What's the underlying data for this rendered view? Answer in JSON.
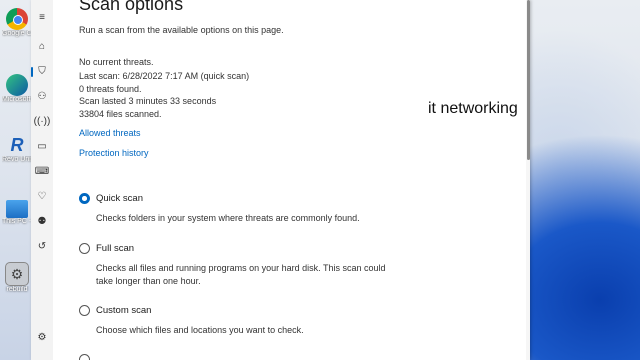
{
  "desktop": {
    "icons": [
      {
        "label": "Google Chrome",
        "short": "Goog\nChrom",
        "icon": "chrome-icon"
      },
      {
        "label": "Microsoft Edge",
        "short": "Micro\nEdg",
        "icon": "edge-icon"
      },
      {
        "label": "Revo Uninstaller",
        "short": "Rev\nUninst",
        "icon": "revo-icon"
      },
      {
        "label": "This PC - Shortcut",
        "short": "This P\nShort",
        "icon": "pc-icon"
      },
      {
        "label": "rebuild",
        "short": "rebu",
        "icon": "gear-app-icon"
      }
    ]
  },
  "window": {
    "nav": [
      "menu-icon",
      "home-icon",
      "shield-icon",
      "person-icon",
      "wifi-icon",
      "app-browser-icon",
      "laptop-icon",
      "heart-icon",
      "family-icon",
      "history-icon",
      "settings-icon"
    ],
    "title": "Scan options",
    "subtitle": "Run a scan from the available options on this page.",
    "status": {
      "threats": "No current threats.",
      "last_scan": "Last scan: 6/28/2022 7:17 AM (quick scan)",
      "found": "0 threats found.",
      "duration": "Scan lasted 3 minutes 33 seconds",
      "files": "33804 files scanned."
    },
    "links": {
      "allowed": "Allowed threats",
      "history": "Protection history"
    },
    "options": [
      {
        "label": "Quick scan",
        "checked": true,
        "desc": "Checks folders in your system where threats are commonly found."
      },
      {
        "label": "Full scan",
        "checked": false,
        "desc": "Checks all files and running programs on your hard disk. This scan could take longer than one hour."
      },
      {
        "label": "Custom scan",
        "checked": false,
        "desc": "Choose which files and locations you want to check."
      }
    ]
  },
  "overlay_text": "it networking",
  "colors": {
    "accent": "#0067c0"
  }
}
